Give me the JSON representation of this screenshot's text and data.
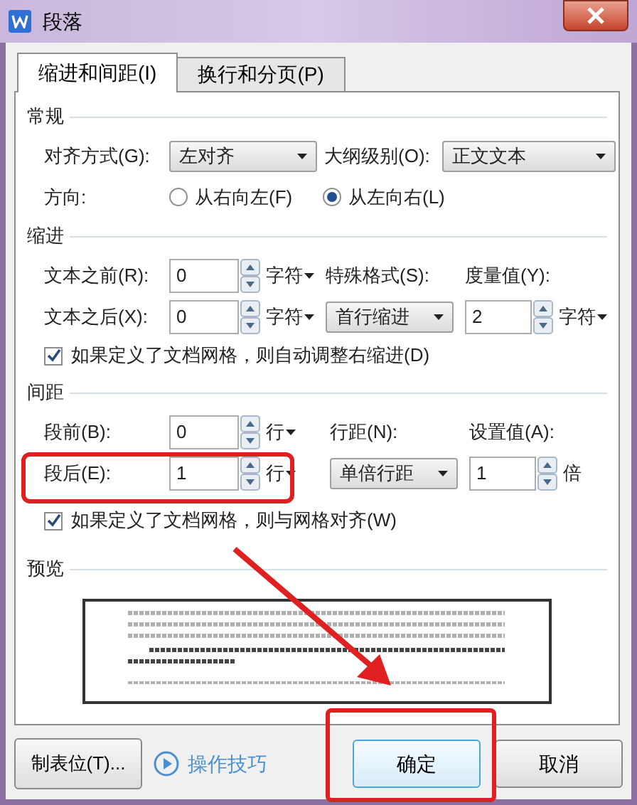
{
  "window": {
    "title": "段落"
  },
  "tabs": [
    {
      "label": "缩进和间距(I)",
      "selected": true
    },
    {
      "label": "换行和分页(P)",
      "selected": false
    }
  ],
  "general": {
    "title": "常规",
    "alignment": {
      "label": "对齐方式(G):",
      "value": "左对齐"
    },
    "outline_level": {
      "label": "大纲级别(O):",
      "value": "正文文本"
    },
    "direction": {
      "label": "方向:",
      "options": [
        {
          "label": "从右向左(F)",
          "selected": false
        },
        {
          "label": "从左向右(L)",
          "selected": true
        }
      ]
    }
  },
  "indent": {
    "title": "缩进",
    "before": {
      "label": "文本之前(R):",
      "value": "0",
      "unit": "字符"
    },
    "after": {
      "label": "文本之后(X):",
      "value": "0",
      "unit": "字符"
    },
    "special": {
      "label": "特殊格式(S):",
      "value": "首行缩进"
    },
    "measure": {
      "label": "度量值(Y):",
      "value": "2",
      "unit": "字符"
    },
    "auto_adjust": {
      "label": "如果定义了文档网格，则自动调整右缩进(D)",
      "checked": true
    }
  },
  "spacing": {
    "title": "间距",
    "before": {
      "label": "段前(B):",
      "value": "0",
      "unit": "行"
    },
    "after": {
      "label": "段后(E):",
      "value": "1",
      "unit": "行",
      "highlighted": true
    },
    "line_spacing": {
      "label": "行距(N):",
      "value": "单倍行距"
    },
    "setting": {
      "label": "设置值(A):",
      "value": "1",
      "unit": "倍"
    },
    "snap_grid": {
      "label": "如果定义了文档网格，则与网格对齐(W)",
      "checked": true
    }
  },
  "preview": {
    "title": "预览"
  },
  "buttons": {
    "tab_stops": "制表位(T)...",
    "tips": "操作技巧",
    "ok": {
      "label": "确定",
      "highlighted": true
    },
    "cancel": "取消"
  }
}
